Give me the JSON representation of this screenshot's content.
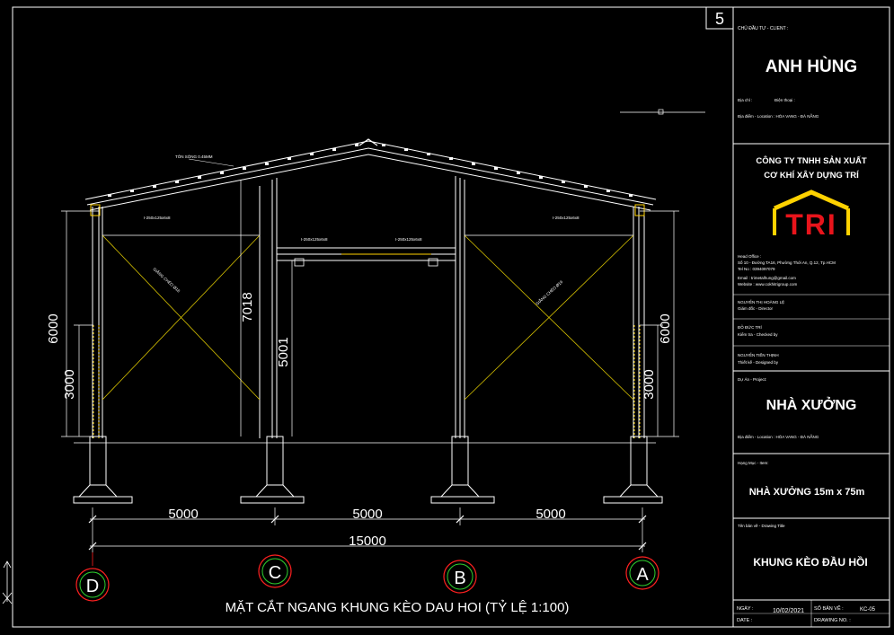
{
  "sheet_number": "5",
  "drawing": {
    "caption": "MẶT CẮT NGANG KHUNG KÈO  DAU HOI  (TỶ LỆ 1:100)",
    "spans": [
      "5000",
      "5000",
      "5000"
    ],
    "total_span": "15000",
    "left_dims": [
      "6000",
      "3000"
    ],
    "right_dims": [
      "6000",
      "3000"
    ],
    "inner_dims": [
      "7018",
      "5001"
    ],
    "axes": [
      "D",
      "C",
      "B",
      "A"
    ],
    "roof_note": "TÔN SÓNG 0.45MM",
    "member_labels": [
      "I-250x125x6x8",
      "I-250x125x6x8",
      "I-250x125x6x8",
      "I-250x125x6x8"
    ],
    "brace_labels": [
      "GIẰNG CHÉO Ø16",
      "GIẰNG CHÉO Ø16"
    ]
  },
  "title_block": {
    "client_label": "CHỦ ĐẦU TƯ - CLIENT :",
    "client_name": "ANH HÙNG",
    "client_addr_label": "Địa chỉ :",
    "client_phone_label": "Điện thoại :",
    "client_location": "Địa điểm - Location : HÒA VANG - ĐÀ NẴNG",
    "company_line1": "CÔNG TY TNHH SẢN XUẤT",
    "company_line2": "CƠ KHÍ XÂY DỰNG TRÍ",
    "logo_text": "TRI",
    "company_info": [
      "Head Office :",
      "Số 10 - Đường TA16, Phường Thới An, Q.12, Tp.HCM",
      "Tel No :   0394097079",
      "Email :   trimetalhung@gmail.com",
      "Website :   www.cokhitrigroup.com"
    ],
    "director": "NGUYỄN THỊ HOÀNG LỆ",
    "director_role": "Giám đốc - Director",
    "checker": "ĐỖ ĐỨC TRÍ",
    "checker_role": "Kiểm tra - Checked by",
    "designer": "NGUYỄN TIẾN THỊNH",
    "designer_role": "Thiết kế - Designed by",
    "project_label": "Dự Án - Project:",
    "project_name": "NHÀ XƯỞNG",
    "project_location": "Địa điểm - Location : HÒA VANG - ĐÀ NẴNG",
    "item_label": "Hạng Mục - Item:",
    "item_name": "NHÀ XƯỞNG 15m x 75m",
    "drawing_title_label": "Tên bản vẽ - Drawing Title",
    "drawing_title": "KHUNG KÈO ĐẦU HỒI",
    "date_label": "NGÀY :",
    "date_label_en": "DATE :",
    "date": "10/02/2021",
    "drawing_no_label": "SỐ BẢN VẼ :",
    "drawing_no_label_en": "DRAWING NO. :",
    "drawing_no": "KC-05"
  }
}
